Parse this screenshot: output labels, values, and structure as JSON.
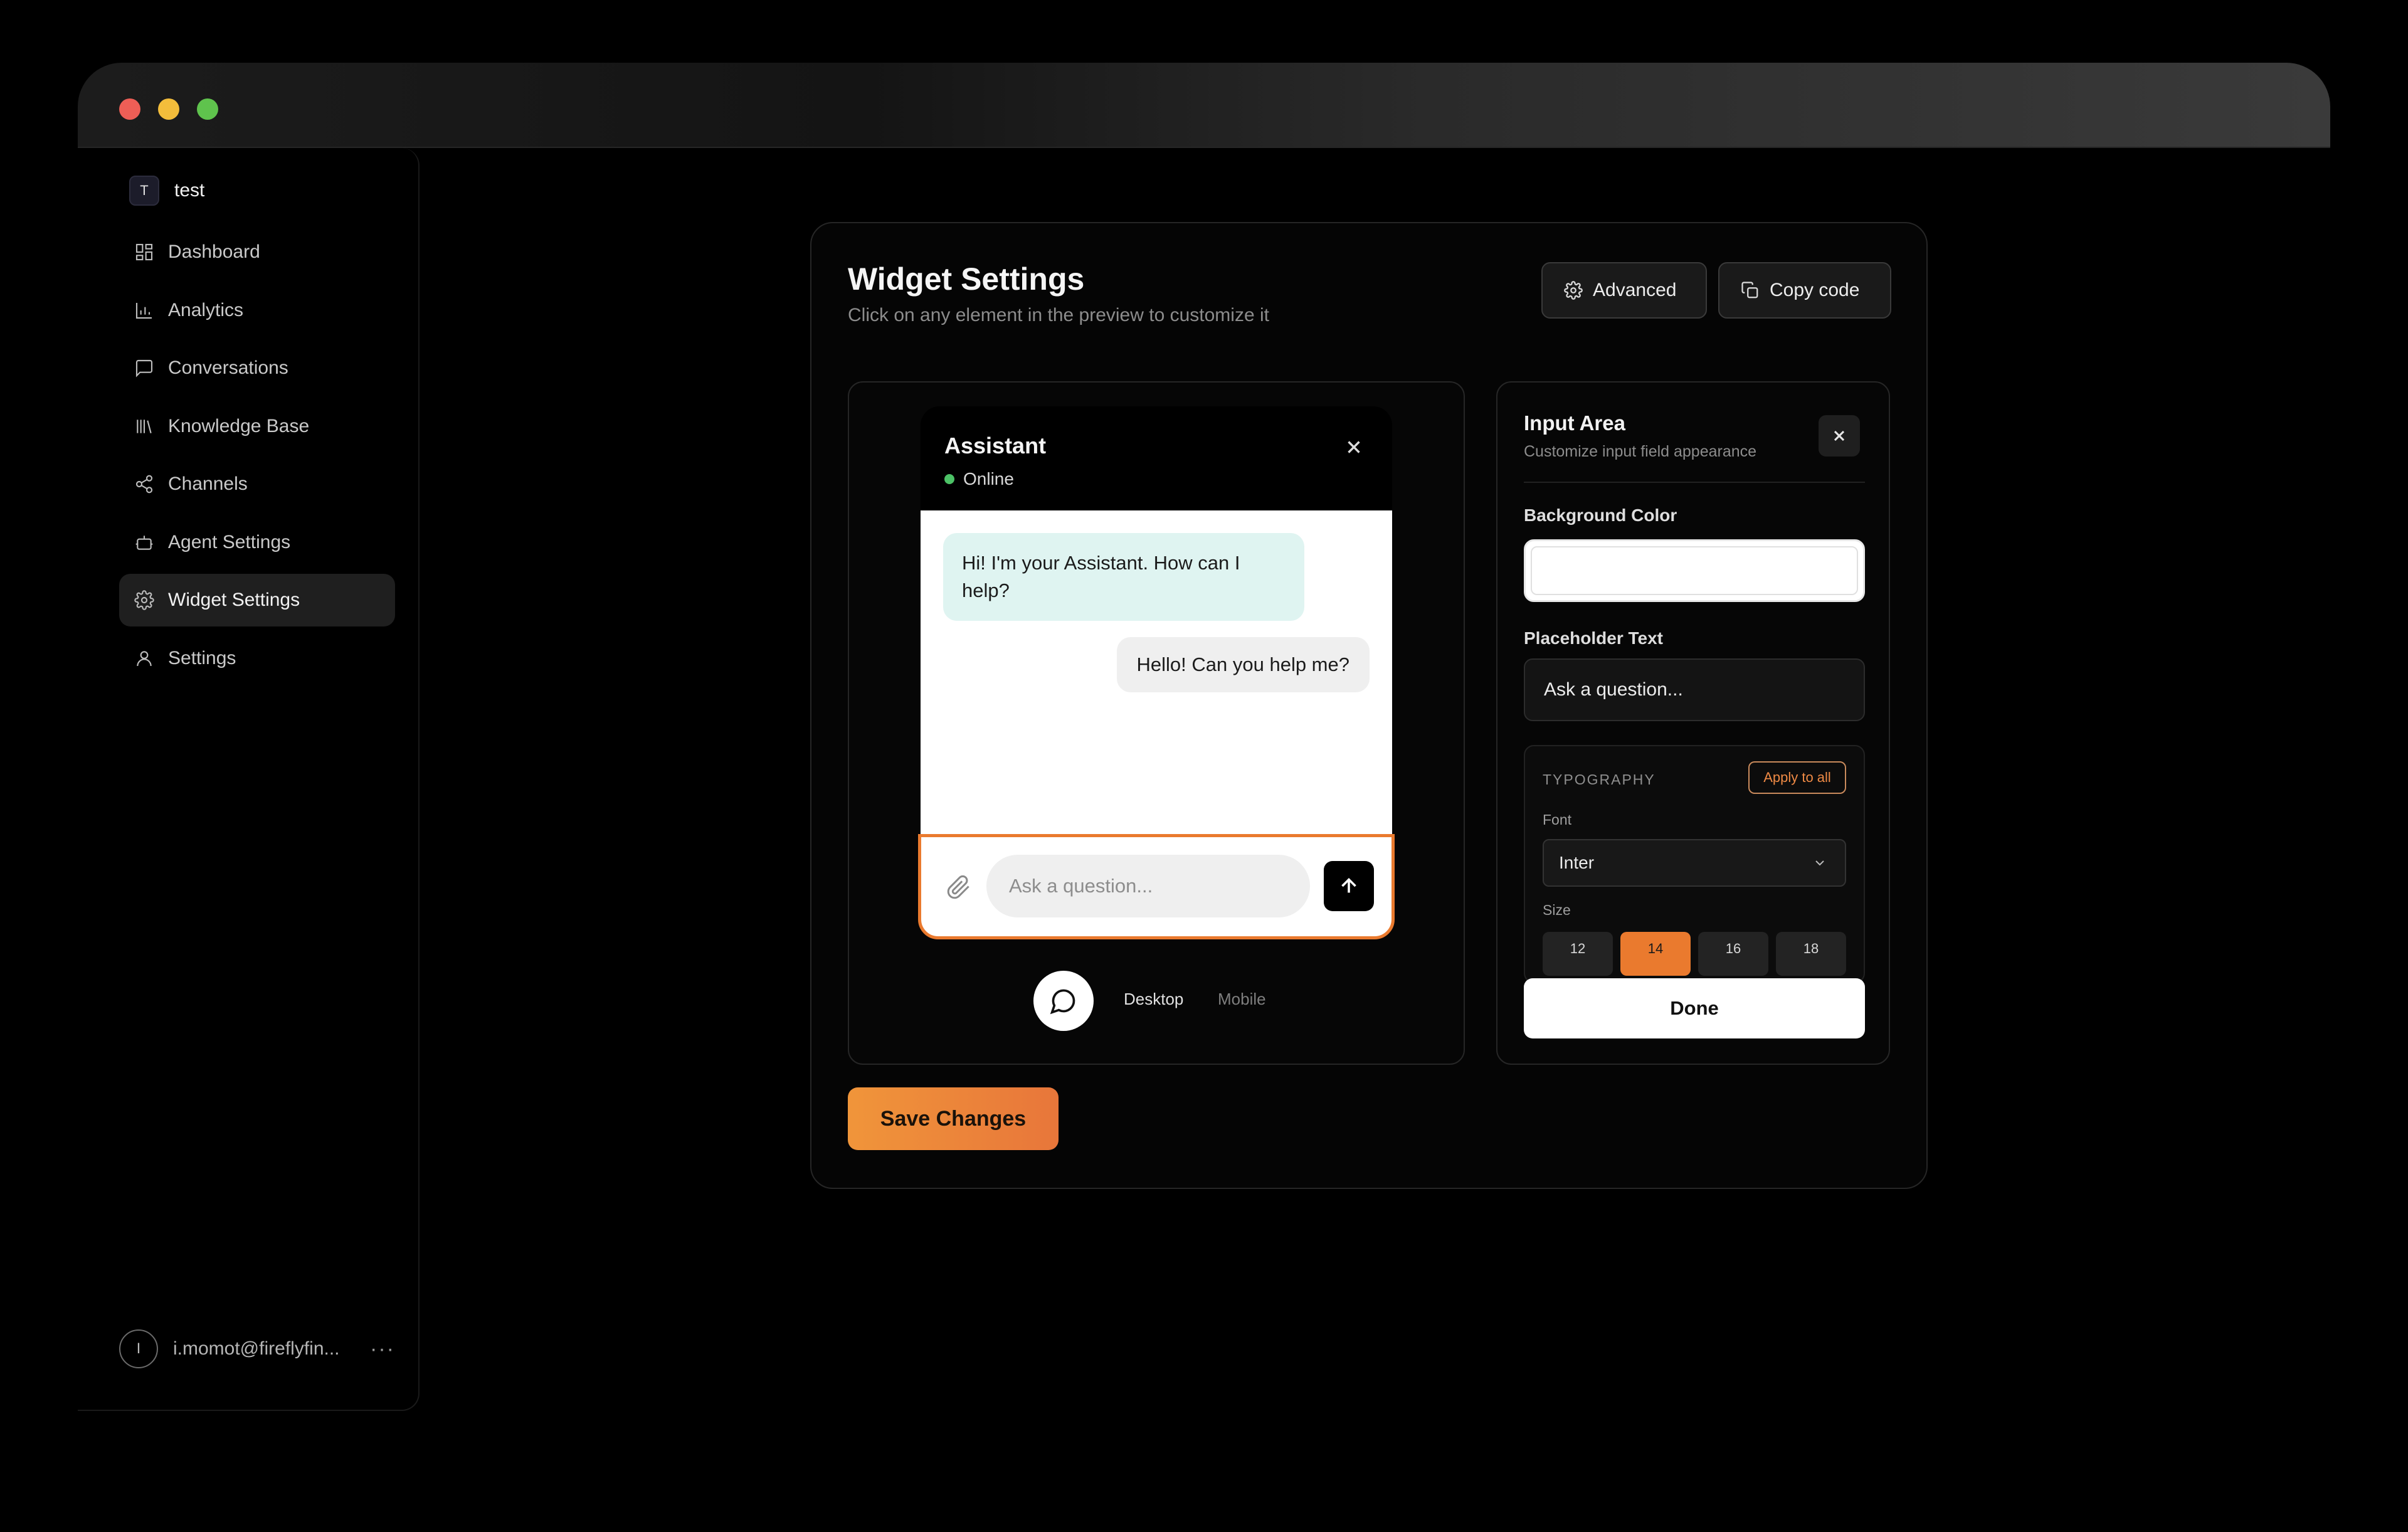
{
  "workspace": {
    "initial": "T",
    "name": "test"
  },
  "nav": [
    {
      "label": "Dashboard",
      "icon": "dashboard-icon"
    },
    {
      "label": "Analytics",
      "icon": "bar-chart-icon"
    },
    {
      "label": "Conversations",
      "icon": "message-square-icon"
    },
    {
      "label": "Knowledge Base",
      "icon": "library-icon"
    },
    {
      "label": "Channels",
      "icon": "share-icon"
    },
    {
      "label": "Agent Settings",
      "icon": "bot-icon"
    },
    {
      "label": "Widget Settings",
      "icon": "gear-icon",
      "active": true
    },
    {
      "label": "Settings",
      "icon": "user-icon"
    }
  ],
  "user": {
    "initial": "I",
    "email": "i.momot@fireflyfin...",
    "more": "···"
  },
  "page": {
    "title": "Widget Settings",
    "subtitle": "Click on any element in the preview to customize it",
    "advanced_label": "Advanced",
    "copy_label": "Copy code",
    "save_label": "Save Changes"
  },
  "widget": {
    "name": "Assistant",
    "status": "Online",
    "bot_message": "Hi! I'm your Assistant. How can I help?",
    "user_message": "Hello! Can you help me?",
    "input_placeholder": "Ask a question...",
    "tabs": {
      "desktop": "Desktop",
      "mobile": "Mobile"
    }
  },
  "editor": {
    "title": "Input Area",
    "subtitle": "Customize input field appearance",
    "bg_label": "Background Color",
    "bg_value": "#ffffff",
    "placeholder_label": "Placeholder Text",
    "placeholder_value": "Ask a question...",
    "typography": {
      "heading": "TYPOGRAPHY",
      "apply_label": "Apply to all",
      "font_label": "Font",
      "font_value": "Inter",
      "size_label": "Size",
      "sizes": [
        "12",
        "14",
        "16",
        "18"
      ],
      "selected_size": "14"
    },
    "done_label": "Done"
  },
  "colors": {
    "accent": "#ea7a2e",
    "online": "#4cc266",
    "bot_bubble": "#dff4f1"
  }
}
